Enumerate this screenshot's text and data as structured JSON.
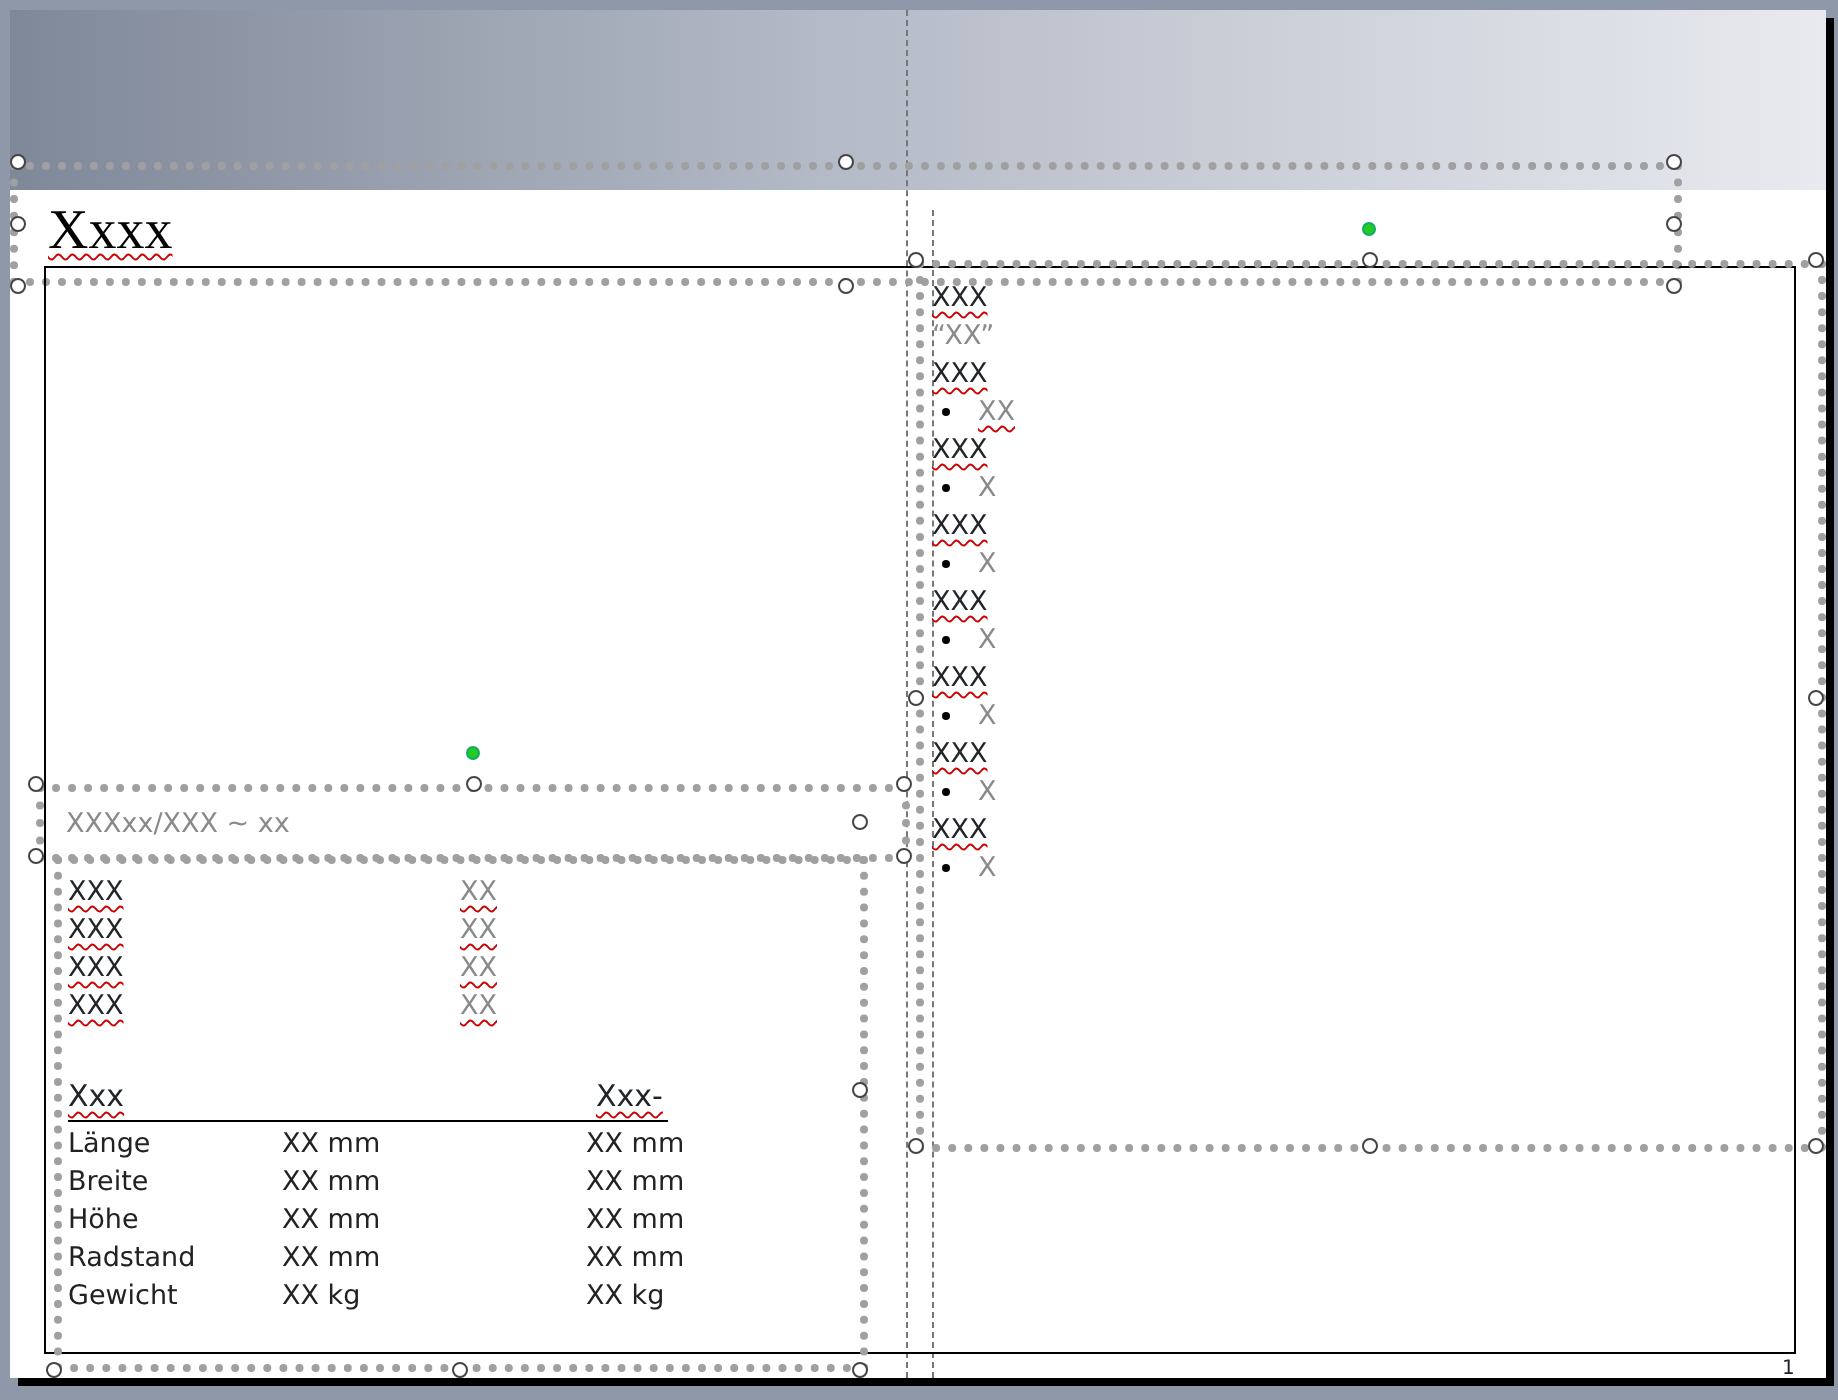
{
  "slide": {
    "title": "Xxxx",
    "caption": "XXXxx/XXX ~ xx",
    "table": [
      {
        "label": "XXX",
        "value": "XX"
      },
      {
        "label": "XXX",
        "value": "XX"
      },
      {
        "label": "XXX",
        "value": "XX"
      },
      {
        "label": "XXX",
        "value": "XX"
      }
    ],
    "specs": {
      "columns": [
        "Xxx",
        "Xxx-"
      ],
      "rows": [
        {
          "label": "Länge",
          "values": [
            "XX mm",
            "XX mm"
          ]
        },
        {
          "label": "Breite",
          "values": [
            "XX mm",
            "XX mm"
          ]
        },
        {
          "label": "Höhe",
          "values": [
            "XX mm",
            "XX mm"
          ]
        },
        {
          "label": "Radstand",
          "values": [
            "XX mm",
            "XX mm"
          ]
        },
        {
          "label": "Gewicht",
          "values": [
            "XX kg",
            "XX kg"
          ]
        }
      ]
    },
    "notes": [
      {
        "kind": "heading",
        "text": "XXX"
      },
      {
        "kind": "quote",
        "text": "“XX”"
      },
      {
        "kind": "heading",
        "text": "XXX"
      },
      {
        "kind": "bullet",
        "text": "XX"
      },
      {
        "kind": "heading",
        "text": "XXX"
      },
      {
        "kind": "bullet",
        "text": "X"
      },
      {
        "kind": "heading",
        "text": "XXX"
      },
      {
        "kind": "bullet",
        "text": "X"
      },
      {
        "kind": "heading",
        "text": "XXX"
      },
      {
        "kind": "bullet",
        "text": "X"
      },
      {
        "kind": "heading",
        "text": "XXX"
      },
      {
        "kind": "bullet",
        "text": "X"
      },
      {
        "kind": "heading",
        "text": "XXX"
      },
      {
        "kind": "bullet",
        "text": "X"
      },
      {
        "kind": "heading",
        "text": "XXX"
      },
      {
        "kind": "bullet",
        "text": "X"
      }
    ],
    "page_number": "1"
  }
}
